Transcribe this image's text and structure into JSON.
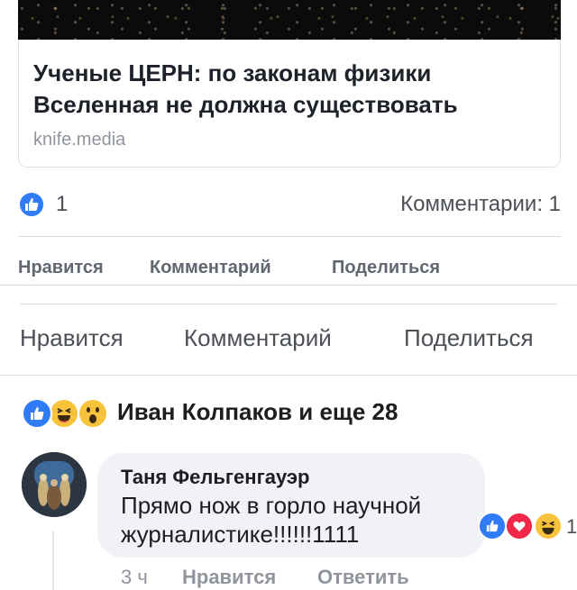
{
  "link_preview": {
    "title": "Ученые ЦЕРН: по законам физики Вселенная не должна существовать",
    "domain": "knife.media"
  },
  "post_stats": {
    "like_count": "1",
    "comments_label": "Комментарии: 1"
  },
  "actions_small": {
    "like": "Нравится",
    "comment": "Комментарий",
    "share": "Поделиться"
  },
  "actions_big": {
    "like": "Нравится",
    "comment": "Комментарий",
    "share": "Поделиться"
  },
  "reactions_summary": {
    "text": "Иван Колпаков и еще 28",
    "icons": [
      "like-icon",
      "haha-icon",
      "wow-icon"
    ]
  },
  "comment": {
    "author": "Таня Фельгенгауэр",
    "text": "Прямо нож в горло научной журналистике!!!!!!1111",
    "time": "3 ч",
    "like_label": "Нравится",
    "reply_label": "Ответить",
    "reaction_count": "1",
    "reaction_icons": [
      "like-icon",
      "love-icon",
      "haha-icon"
    ]
  },
  "colors": {
    "like_blue": "#2f7cf6",
    "love_red": "#f0284a",
    "haha_yellow": "#f7c33d",
    "muted_text": "#90949c",
    "bubble_bg": "#f0f2f5"
  }
}
